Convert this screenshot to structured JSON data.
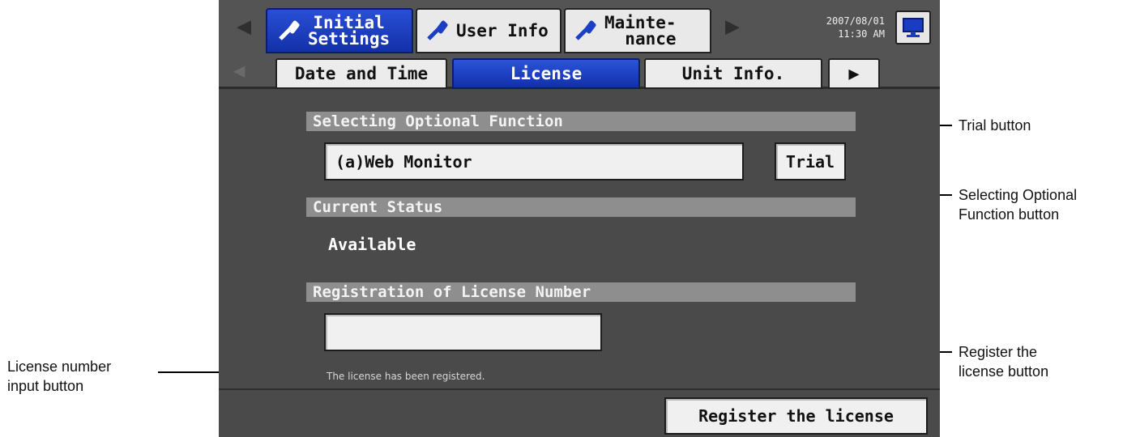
{
  "header": {
    "tabs": [
      {
        "label": "Initial\nSettings",
        "active": true
      },
      {
        "label": "User Info",
        "active": false
      },
      {
        "label": "Mainte-\nnance",
        "active": false
      }
    ],
    "datetime": {
      "date": "2007/08/01",
      "time": "11:30 AM"
    }
  },
  "subtabs": [
    {
      "label": "Date and Time",
      "active": false
    },
    {
      "label": "License",
      "active": true
    },
    {
      "label": "Unit Info.",
      "active": false
    }
  ],
  "optional_function": {
    "section_title": "Selecting Optional Function",
    "selected": "(a)Web Monitor",
    "trial_label": "Trial"
  },
  "current_status": {
    "section_title": "Current Status",
    "value": "Available"
  },
  "license": {
    "section_title": "Registration of License Number",
    "input_value": "",
    "note": "The license has been registered.",
    "register_label": "Register the license"
  },
  "callouts": {
    "trial": "Trial button",
    "selecting": "Selecting Optional\nFunction button",
    "register": "Register the\nlicense button",
    "license_input": "License number\ninput button"
  },
  "colors": {
    "screen_bg": "#4a4a4a",
    "active_tab": "#1a3cc0",
    "section_bar": "#8e8e8e"
  }
}
